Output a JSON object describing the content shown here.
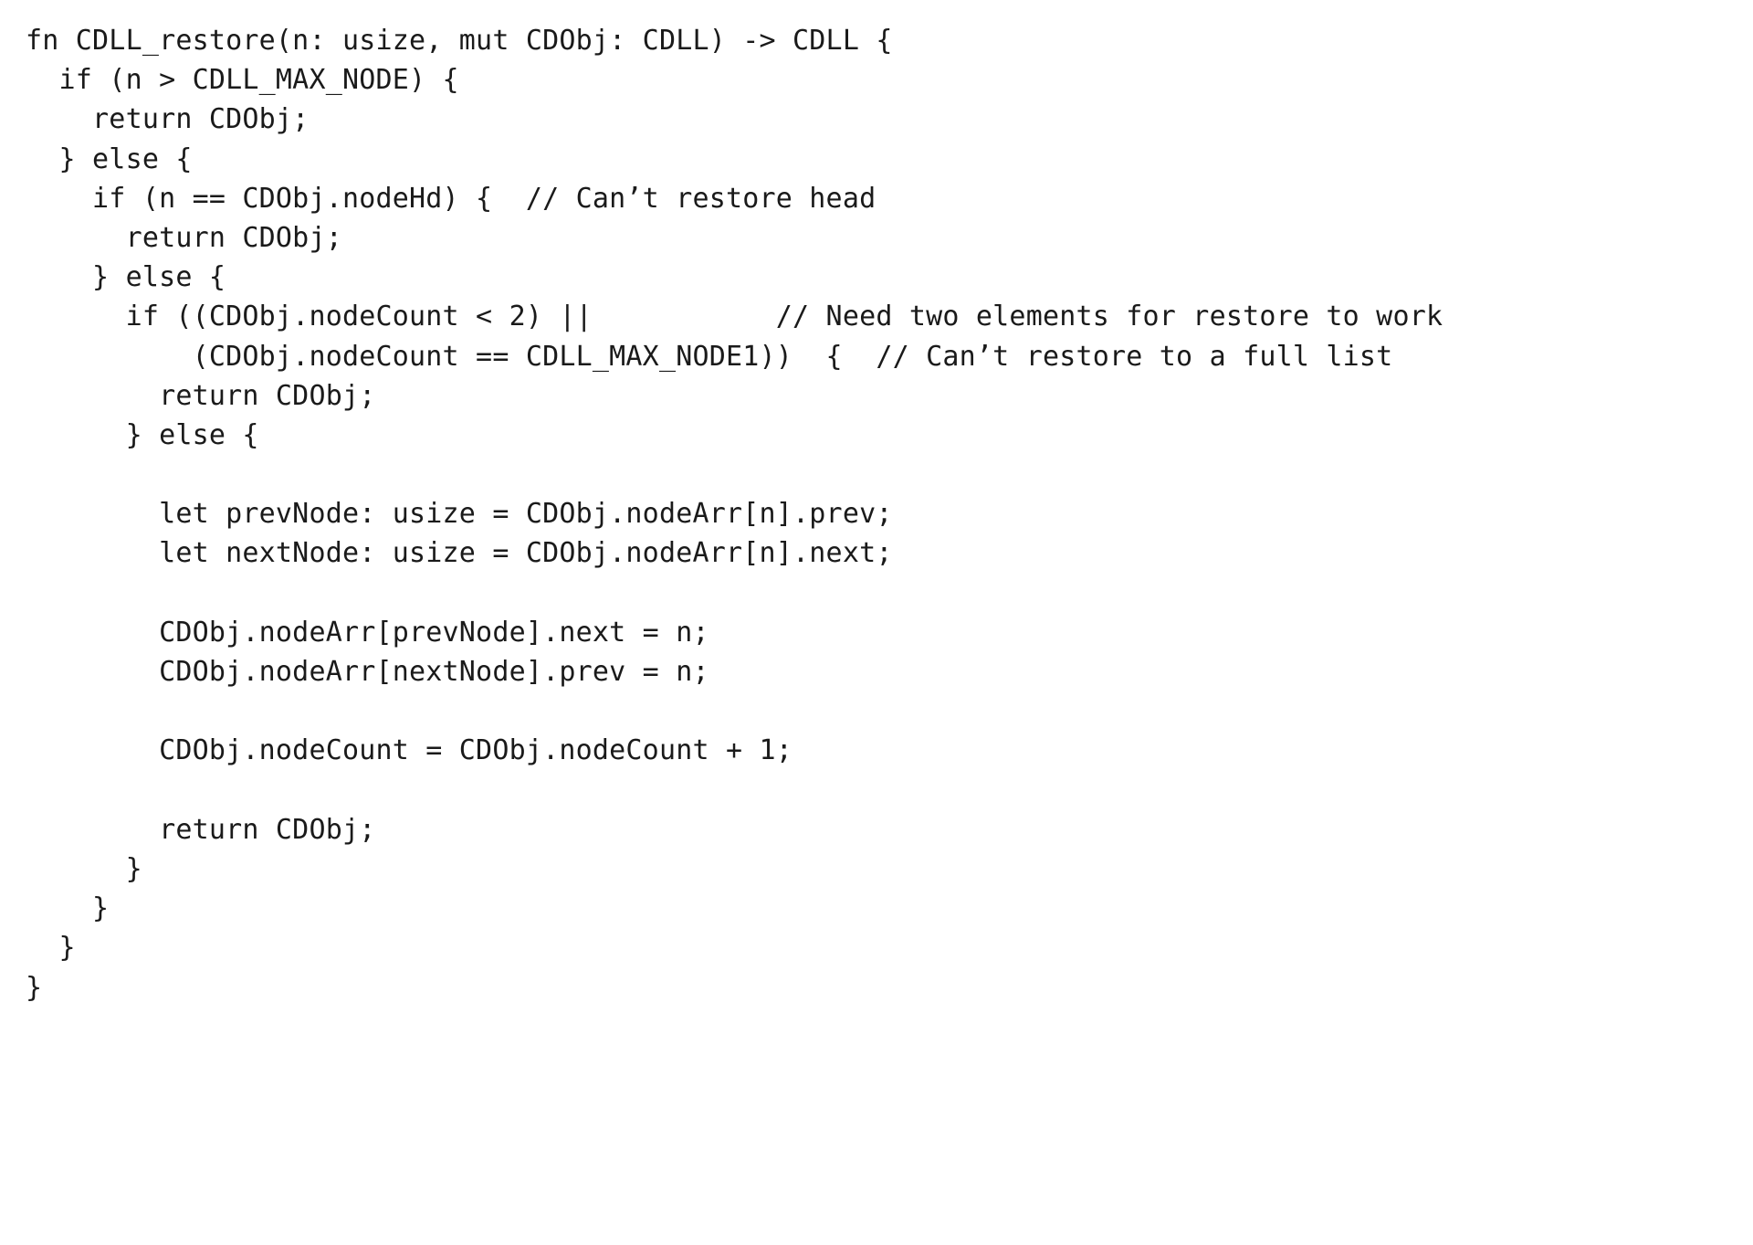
{
  "document": {
    "type": "code-listing",
    "language": "Rust",
    "function_name": "CDLL_restore",
    "background_color": "#ffffff",
    "text_color": "#1a1a1a"
  },
  "code": {
    "lines": [
      "fn CDLL_restore(n: usize, mut CDObj: CDLL) -> CDLL {",
      "  if (n > CDLL_MAX_NODE) {",
      "    return CDObj;",
      "  } else {",
      "    if (n == CDObj.nodeHd) {  // Can’t restore head",
      "      return CDObj;",
      "    } else {",
      "      if ((CDObj.nodeCount < 2) ||           // Need two elements for restore to work",
      "          (CDObj.nodeCount == CDLL_MAX_NODE1))  {  // Can’t restore to a full list",
      "        return CDObj;",
      "      } else {",
      "",
      "        let prevNode: usize = CDObj.nodeArr[n].prev;",
      "        let nextNode: usize = CDObj.nodeArr[n].next;",
      "",
      "        CDObj.nodeArr[prevNode].next = n;",
      "        CDObj.nodeArr[nextNode].prev = n;",
      "",
      "        CDObj.nodeCount = CDObj.nodeCount + 1;",
      "",
      "        return CDObj;",
      "      }",
      "    }",
      "  }",
      "}"
    ]
  }
}
